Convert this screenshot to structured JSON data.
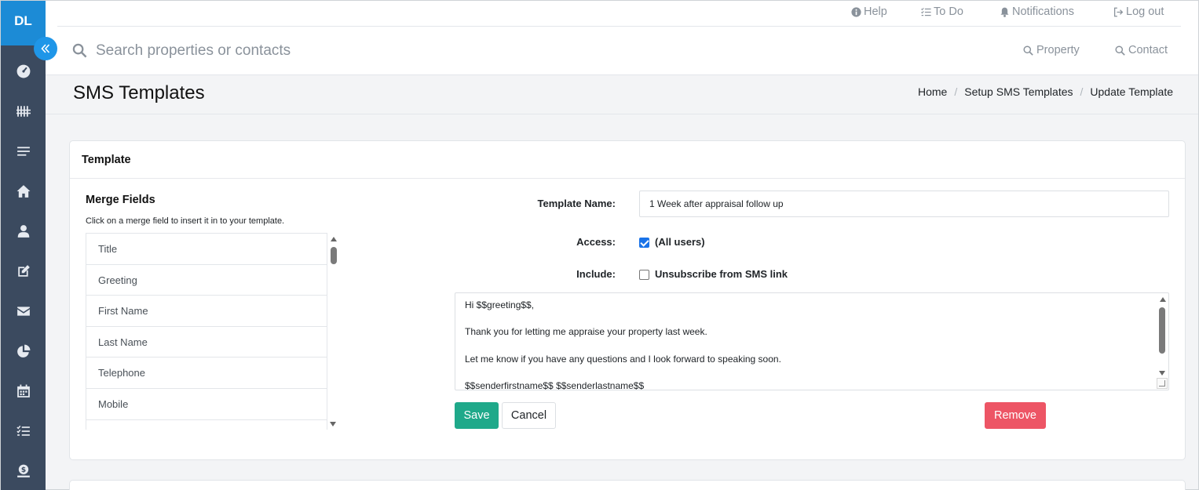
{
  "sidebar": {
    "logo": "DL",
    "icons": [
      "dashboard-icon",
      "properties-icon",
      "list-icon",
      "home-icon",
      "contact-icon",
      "edit-icon",
      "mail-icon",
      "reports-icon",
      "calendar-icon",
      "tasks-icon",
      "finance-icon"
    ]
  },
  "topbar": {
    "help": "Help",
    "todo": "To Do",
    "notifications": "Notifications",
    "logout": "Log out"
  },
  "search": {
    "placeholder": "Search properties or contacts",
    "property": "Property",
    "contact": "Contact"
  },
  "page": {
    "title": "SMS Templates",
    "breadcrumb": [
      "Home",
      "Setup SMS Templates",
      "Update Template"
    ]
  },
  "card": {
    "title": "Template",
    "merge_fields": {
      "title": "Merge Fields",
      "description": "Click on a merge field to insert it in to your template.",
      "items": [
        "Title",
        "Greeting",
        "First Name",
        "Last Name",
        "Telephone",
        "Mobile",
        ""
      ]
    },
    "form": {
      "name_label": "Template Name:",
      "name_value": "1 Week after appraisal follow up",
      "access_label": "Access:",
      "access_option": "(All users)",
      "access_checked": true,
      "include_label": "Include:",
      "include_option": "Unsubscribe from SMS link",
      "include_checked": false,
      "message_lines": [
        "Hi $$greeting$$,",
        "Thank you for letting me appraise your property last week.",
        "Let me know if you have any questions and I look forward to speaking soon.",
        "$$senderfirstname$$ $$senderlastname$$"
      ]
    },
    "buttons": {
      "save": "Save",
      "cancel": "Cancel",
      "remove": "Remove"
    }
  },
  "colors": {
    "sidebar": "#3b4a5f",
    "logo": "#1c8bd6",
    "save": "#1fa98a",
    "remove": "#ed5565"
  }
}
